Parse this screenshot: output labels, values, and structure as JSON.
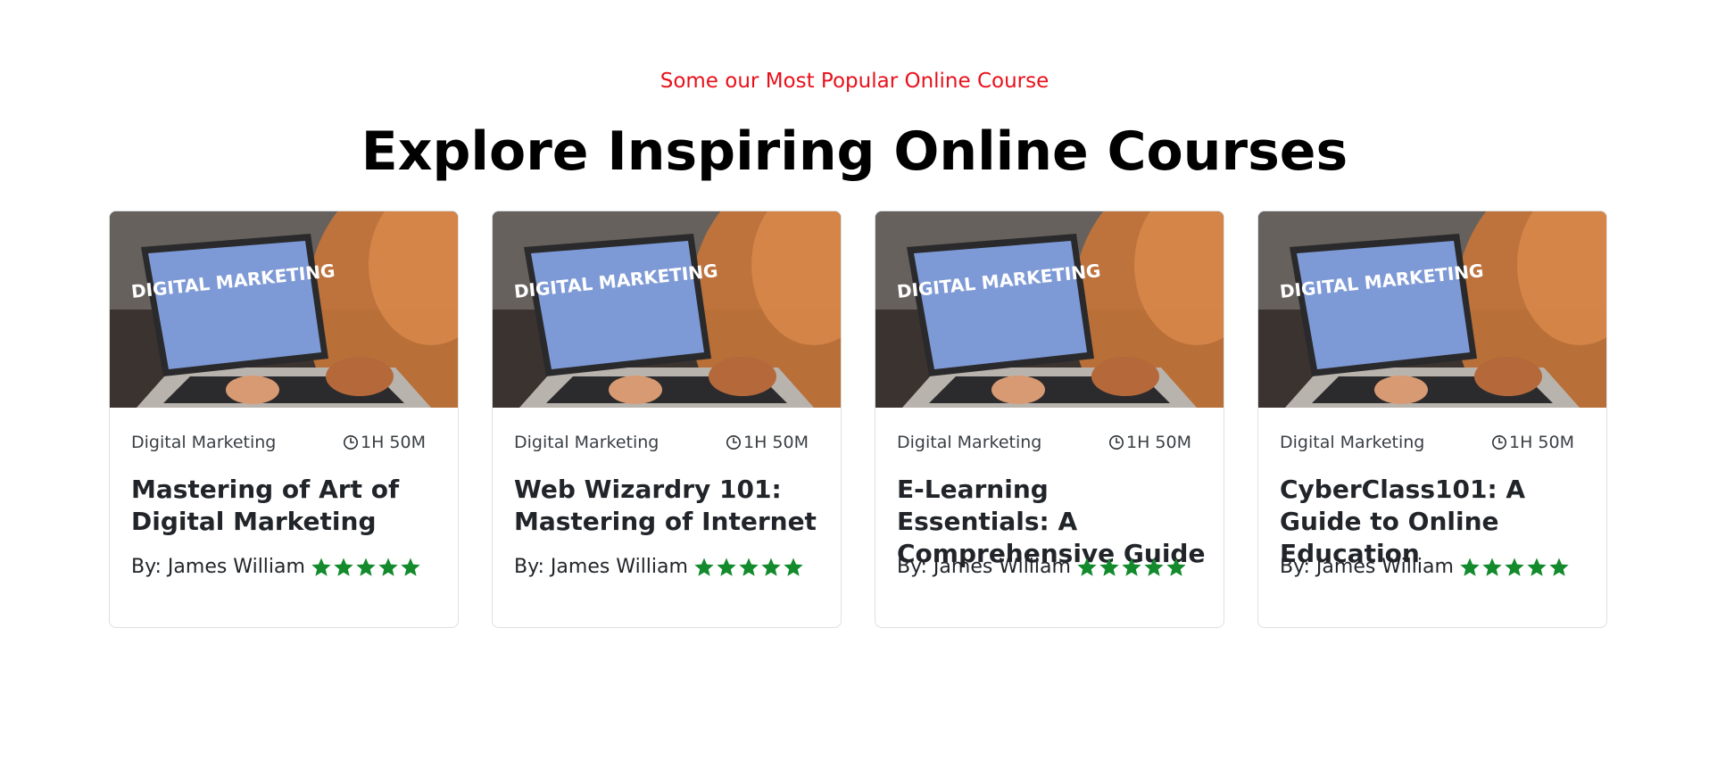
{
  "section": {
    "eyebrow": "Some our Most Popular Online Course",
    "heading": "Explore Inspiring Online Courses"
  },
  "colors": {
    "eyebrow": "#e8111b",
    "star": "#138a2c",
    "card_border": "#dcdfe2"
  },
  "icons": {
    "duration": "clock-icon",
    "rating": "star-icon"
  },
  "courses": [
    {
      "category": "Digital Marketing",
      "duration": "1H 50M",
      "title": "Mastering of Art of Digital Marketing",
      "author": "By: James William",
      "rating": 5,
      "image_text": "DIGITAL MARKETING"
    },
    {
      "category": "Digital Marketing",
      "duration": "1H 50M",
      "title": "Web Wizardry 101: Mastering of Internet",
      "author": "By: James William",
      "rating": 5,
      "image_text": "DIGITAL MARKETING"
    },
    {
      "category": "Digital Marketing",
      "duration": "1H 50M",
      "title": "E-Learning Essentials: A Comprehensive Guide",
      "author": "By: James William",
      "rating": 5,
      "image_text": "DIGITAL MARKETING"
    },
    {
      "category": "Digital Marketing",
      "duration": "1H 50M",
      "title": "CyberClass101: A Guide to Online Education",
      "author": "By: James William",
      "rating": 5,
      "image_text": "DIGITAL MARKETING"
    }
  ]
}
